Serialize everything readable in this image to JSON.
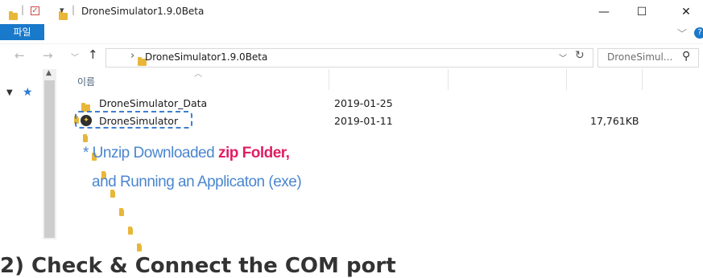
{
  "window": {
    "title": "DroneSimulator1.9.0Beta",
    "minimize": "—",
    "maximize": "☐",
    "close": "✕",
    "qat_down": "▾"
  },
  "ribbon": {
    "file_tab": "파일",
    "expand": "﹀",
    "help": "?"
  },
  "nav": {
    "back": "←",
    "forward": "→",
    "recent": "﹀",
    "up": "↑",
    "crumb_sep": "›",
    "path": "DroneSimulator1.9.0Beta",
    "dropdown": "﹀",
    "refresh": "↻"
  },
  "search": {
    "placeholder": "DroneSimul...",
    "icon": "⚲"
  },
  "columns": {
    "name": "이름"
  },
  "files": [
    {
      "name": "DroneSimulator_Data",
      "date": "2019-01-25",
      "size": ""
    },
    {
      "name": "DroneSimulator",
      "date": "2019-01-11",
      "size": "17,761KB"
    }
  ],
  "annotation": {
    "line1_prefix": "* Unzip Downloaded ",
    "line1_highlight": "zip Folder,",
    "line2": "and Running an Applicaton (exe)"
  },
  "heading": "2) Check & Connect the COM port",
  "colors": {
    "accent": "#1979ca",
    "annotation_blue": "#4a86cf",
    "annotation_pink": "#e01e63",
    "dashed_box": "#3d7fd1",
    "folder": "#e8b73a"
  }
}
